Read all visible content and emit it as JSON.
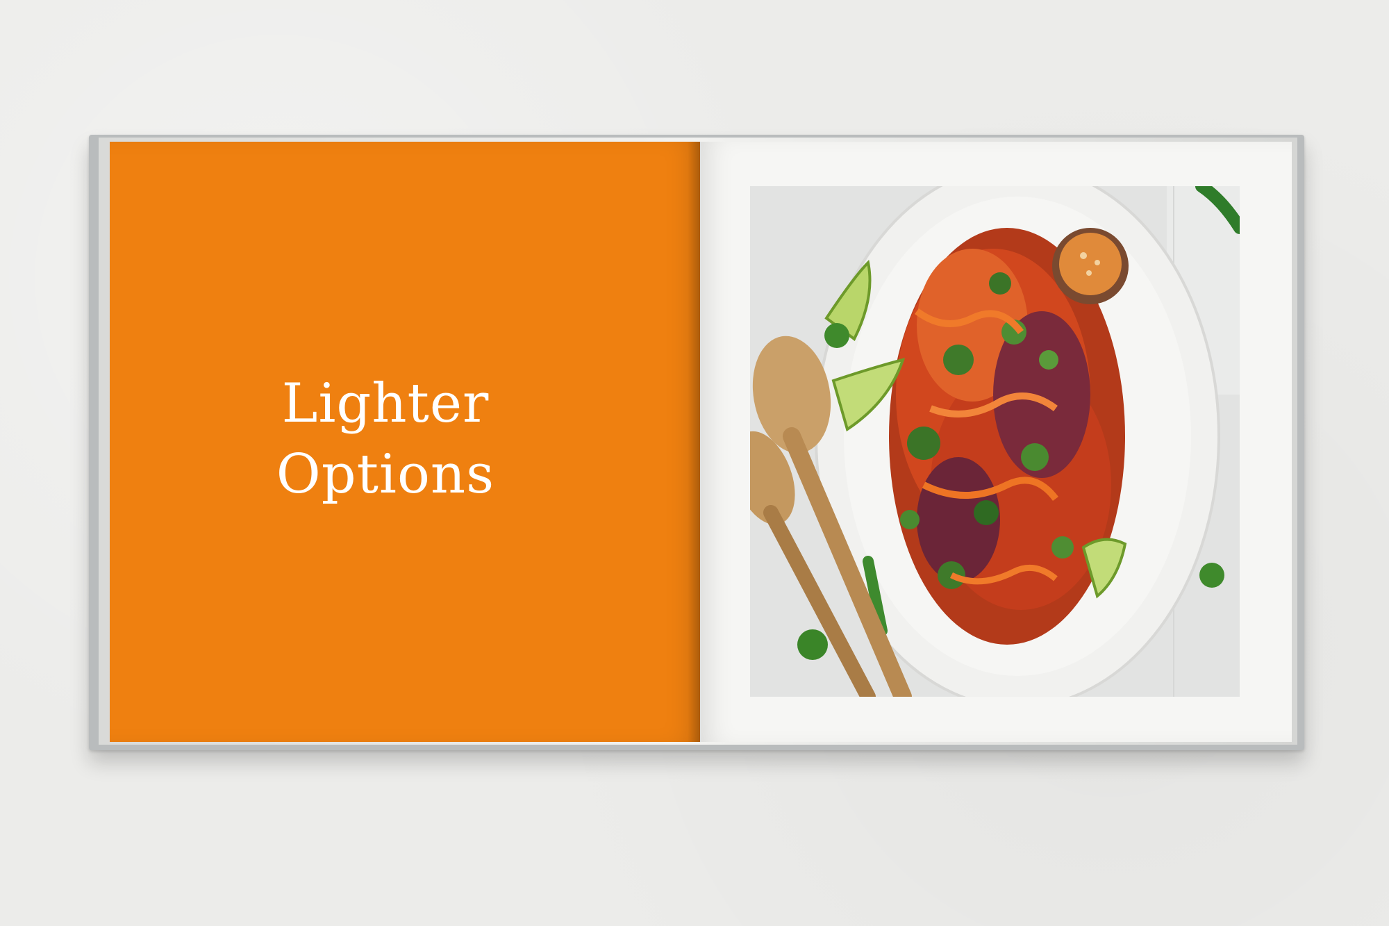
{
  "book": {
    "left_page": {
      "background_color": "#ef8010",
      "title_lines": [
        "Lighter",
        "Options"
      ]
    },
    "right_page": {
      "background_color": "#f6f6f4",
      "photo_subject": "salad-platter-photo"
    }
  }
}
